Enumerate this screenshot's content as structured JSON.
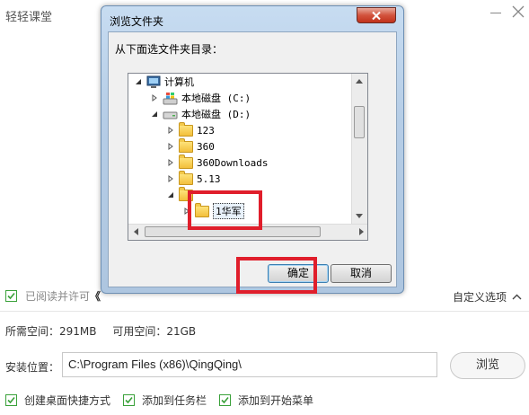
{
  "app": {
    "title": "轻轻课堂"
  },
  "agreement": {
    "text": "已阅读并许可",
    "link": "《",
    "checked": true
  },
  "custom_options": {
    "label": "自定义选项"
  },
  "space": {
    "required": "所需空间：291MB",
    "available": "可用空间：21GB"
  },
  "install": {
    "label": "安装位置：",
    "path": "C:\\Program Files (x86)\\QingQing\\",
    "browse_label": "浏览"
  },
  "options": [
    {
      "label": "创建桌面快捷方式",
      "checked": true
    },
    {
      "label": "添加到任务栏",
      "checked": true
    },
    {
      "label": "添加到开始菜单",
      "checked": true
    }
  ],
  "dialog": {
    "title": "浏览文件夹",
    "prompt": "从下面选文件夹目录：",
    "ok_label": "确定",
    "cancel_label": "取消",
    "tree": [
      {
        "label": "计算机",
        "icon": "computer-icon"
      },
      {
        "label": "本地磁盘 (C:)",
        "icon": "windows-drive-icon"
      },
      {
        "label": "本地磁盘 (D:)",
        "icon": "drive-icon"
      },
      {
        "label": "123",
        "icon": "folder-icon"
      },
      {
        "label": "360",
        "icon": "folder-icon"
      },
      {
        "label": "360Downloads",
        "icon": "folder-icon"
      },
      {
        "label": "5.13",
        "icon": "folder-icon"
      },
      {
        "label": "1华军",
        "icon": "folder-icon"
      }
    ]
  },
  "colors": {
    "highlight": "#e01e2b",
    "check": "#3aa13a",
    "dialog_border": "#6d8fb3"
  }
}
